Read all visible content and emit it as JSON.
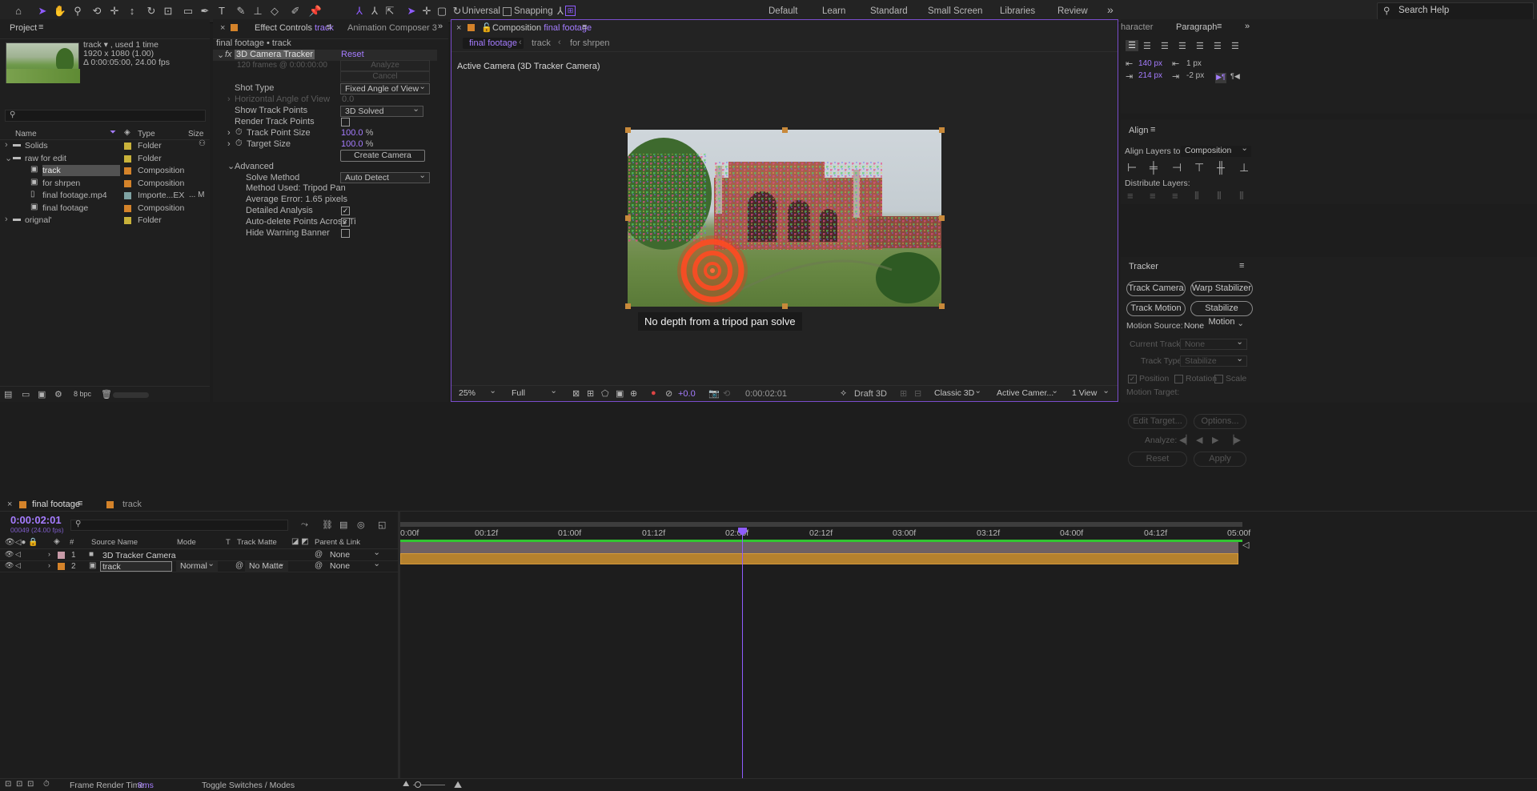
{
  "toolbar": {
    "universal_label": "Universal",
    "snapping_label": "Snapping",
    "workspaces": [
      "Default",
      "Learn",
      "Standard",
      "Small Screen",
      "Libraries",
      "Review"
    ],
    "search_placeholder": "Search Help",
    "more": "»"
  },
  "project": {
    "tab": "Project",
    "thumb_name": "track",
    "thumb_used": ", used 1 time",
    "thumb_res": "1920 x 1080 (1.00)",
    "thumb_dur": "Δ 0:00:05:00, 24.00 fps",
    "columns": {
      "name": "Name",
      "type": "Type",
      "size": "Size"
    },
    "items": [
      {
        "name": "Solids",
        "type": "Folder",
        "color": "#c9b23a",
        "kind": "folder",
        "indent": 0,
        "twirl": "›"
      },
      {
        "name": "raw for edit",
        "type": "Folder",
        "color": "#c9b23a",
        "kind": "folder",
        "indent": 0,
        "twirl": "⌄"
      },
      {
        "name": "track",
        "type": "Composition",
        "color": "#d4832a",
        "kind": "comp",
        "indent": 1,
        "selected": true
      },
      {
        "name": "for shrpen",
        "type": "Composition",
        "color": "#d4832a",
        "kind": "comp",
        "indent": 1
      },
      {
        "name": "final footage.mp4",
        "type": "Importe...EX",
        "color": "#7fa3a3",
        "kind": "file",
        "indent": 1,
        "size": "... M"
      },
      {
        "name": "final footage",
        "type": "Composition",
        "color": "#d4832a",
        "kind": "comp",
        "indent": 1
      },
      {
        "name": "orignal'",
        "type": "Folder",
        "color": "#c9b23a",
        "kind": "folder",
        "indent": 0,
        "twirl": "›"
      }
    ],
    "bpc": "8 bpc"
  },
  "effects": {
    "tab_label": "Effect Controls",
    "tab_layer": "track",
    "tab2": "Animation Composer 3",
    "breadcrumb": "final footage • track",
    "effect_name": "3D Camera Tracker",
    "reset": "Reset",
    "analyze": "Analyze",
    "frames_text": "120 frames @ 0:00:00:00",
    "cancel": "Cancel",
    "shot_type_label": "Shot Type",
    "shot_type_value": "Fixed Angle of View",
    "hangle_label": "Horizontal Angle of View",
    "hangle_value": "0.0",
    "show_points_label": "Show Track Points",
    "show_points_value": "3D Solved",
    "render_points_label": "Render Track Points",
    "point_size_label": "Track Point Size",
    "point_size_value": "100.0",
    "target_size_label": "Target Size",
    "target_size_value": "100.0",
    "percent": "%",
    "create_camera": "Create Camera",
    "advanced": "Advanced",
    "solve_method_label": "Solve Method",
    "solve_method_value": "Auto Detect",
    "method_used": "Method Used: Tripod Pan",
    "avg_error": "Average Error: 1.65 pixels",
    "detailed_label": "Detailed Analysis",
    "autodelete_label": "Auto-delete Points Across Ti",
    "hide_warning_label": "Hide Warning Banner"
  },
  "comp": {
    "tab_label": "Composition",
    "tab_name": "final footage",
    "crumbs": [
      "final footage",
      "track",
      "for shrpen"
    ],
    "camera_label": "Active Camera (3D Tracker Camera)",
    "warning": "No depth from a tripod pan solve",
    "zoom": "25%",
    "resolution": "Full",
    "exposure": "+0.0",
    "timecode": "0:00:02:01",
    "draft": "Draft 3D",
    "renderer": "Classic 3D",
    "camera": "Active Camer...",
    "views": "1 View"
  },
  "right": {
    "tab_char": "haracter",
    "tab_para": "Paragraph",
    "para_vals": {
      "indent_left": "140 px",
      "indent_first": "214 px",
      "space_before": "1 px",
      "space_after": "-2 px"
    },
    "align_title": "Align",
    "align_to_label": "Align Layers to:",
    "align_to_value": "Composition",
    "distribute_label": "Distribute Layers:",
    "tracker_title": "Tracker",
    "track_camera": "Track Camera",
    "warp_stabilizer": "Warp Stabilizer",
    "track_motion": "Track Motion",
    "stabilize_motion": "Stabilize Motion",
    "motion_source_label": "Motion Source:",
    "motion_source_value": "None",
    "current_track_label": "Current Track:",
    "current_track_value": "None",
    "track_type_label": "Track Type:",
    "track_type_value": "Stabilize",
    "position": "Position",
    "rotation": "Rotation",
    "scale": "Scale",
    "motion_target": "Motion Target:",
    "edit_target": "Edit Target...",
    "options": "Options...",
    "analyze": "Analyze:",
    "reset": "Reset",
    "apply": "Apply"
  },
  "timeline": {
    "tab_active": "final footage",
    "tab_other": "track",
    "timecode": "0:00:02:01",
    "frames_text": "00049 (24.00 fps)",
    "cols": {
      "num": "#",
      "source": "Source Name",
      "mode": "Mode",
      "t": "T",
      "matte": "Track Matte",
      "parent": "Parent & Link"
    },
    "layers": [
      {
        "num": "1",
        "name": "3D Tracker Camera",
        "color": "#c79aa7",
        "parent": "None",
        "kind": "camera"
      },
      {
        "num": "2",
        "name": "track",
        "color": "#d4832a",
        "mode": "Normal",
        "matte": "No Matte",
        "parent": "None",
        "kind": "comp"
      }
    ],
    "ticks": [
      "0:00f",
      "00:12f",
      "01:00f",
      "01:12f",
      "02:00f",
      "02:12f",
      "03:00f",
      "03:12f",
      "04:00f",
      "04:12f",
      "05:00f"
    ],
    "playhead_frame": 49,
    "total_frames": 120,
    "render_time_label": "Frame Render Time:",
    "render_time_value": "8ms",
    "toggle_label": "Toggle Switches / Modes"
  },
  "colors": {
    "accent": "#8f5cff",
    "layer_bar": "#b5812e",
    "camera_bar": "#7b6b6e",
    "workarea": "#31c431"
  }
}
